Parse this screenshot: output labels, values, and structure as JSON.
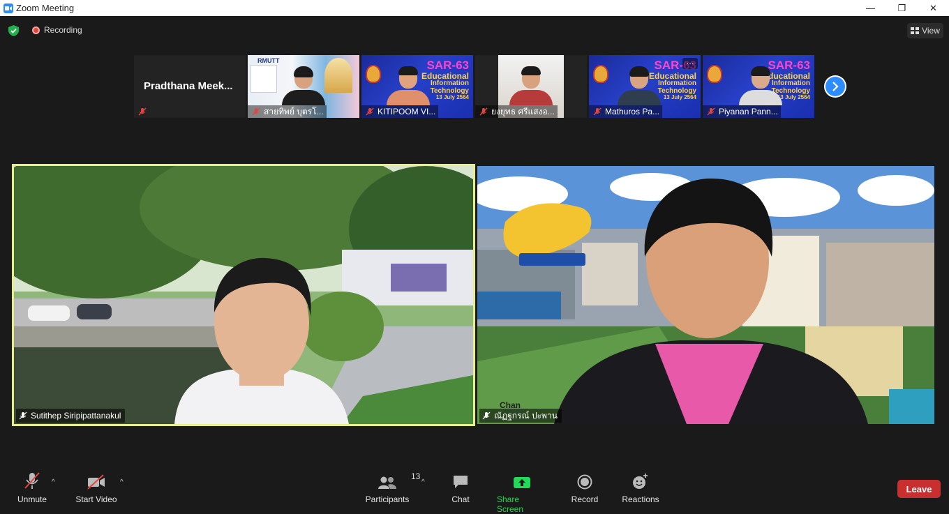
{
  "window": {
    "title": "Zoom Meeting",
    "minimize": "—",
    "maximize": "❐",
    "close": "✕"
  },
  "topbar": {
    "recording_label": "Recording",
    "view_label": "View"
  },
  "thumbnails": [
    {
      "name": "Pradthana  Meek...",
      "label": "",
      "video": false
    },
    {
      "name": "",
      "label": "สายทิพย์ บุตรโ...",
      "video": true
    },
    {
      "name": "",
      "label": "KITIPOOM VI...",
      "video": true
    },
    {
      "name": "",
      "label": "ยงยุทธ ศรีแสงอ...",
      "video": true
    },
    {
      "name": "",
      "label": "Mathuros Pa...",
      "video": true
    },
    {
      "name": "",
      "label": "Piyanan Pann...",
      "video": true
    }
  ],
  "sar_slide": {
    "title": "SAR-63",
    "line1": "Educational",
    "line2": "Information",
    "line3": "Technology",
    "date": "13 July 2564"
  },
  "thumb2_logo": "RMUTT",
  "tiles": {
    "left": {
      "name": "Sutithep Siripipattanakul",
      "active_speaker": true
    },
    "right": {
      "name": "ณัฏฐกรณ์ ปะพาน",
      "bg_text": "Chan"
    }
  },
  "toolbar": {
    "unmute": "Unmute",
    "start_video": "Start Video",
    "participants": "Participants",
    "participants_count": "13",
    "chat": "Chat",
    "share_screen": "Share Screen",
    "record": "Record",
    "reactions": "Reactions",
    "leave": "Leave"
  },
  "colors": {
    "accent": "#2d8cff",
    "share_green": "#23d959",
    "leave_red": "#c8302f",
    "active_border": "#e8ee8a"
  }
}
